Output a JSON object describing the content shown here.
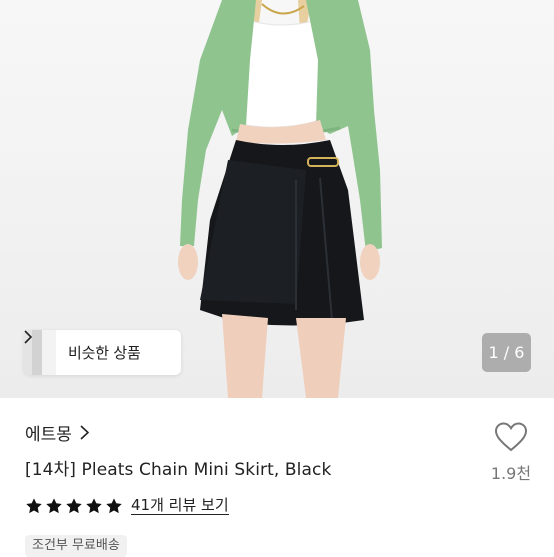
{
  "gallery": {
    "similar_label": "비슷한 상품",
    "counter": "1 / 6"
  },
  "product": {
    "shop_name": "에트몽",
    "title": "[14차] Pleats Chain Mini Skirt, Black",
    "like_count": "1.9천",
    "review_link": "41개 리뷰 보기",
    "rating_stars": 5,
    "shipping_badge": "조건부 무료배송"
  },
  "colors": {
    "star": "#111111",
    "heart_outline": "#777777",
    "cardigan": "#8fc48f",
    "skirt": "#15171a"
  }
}
